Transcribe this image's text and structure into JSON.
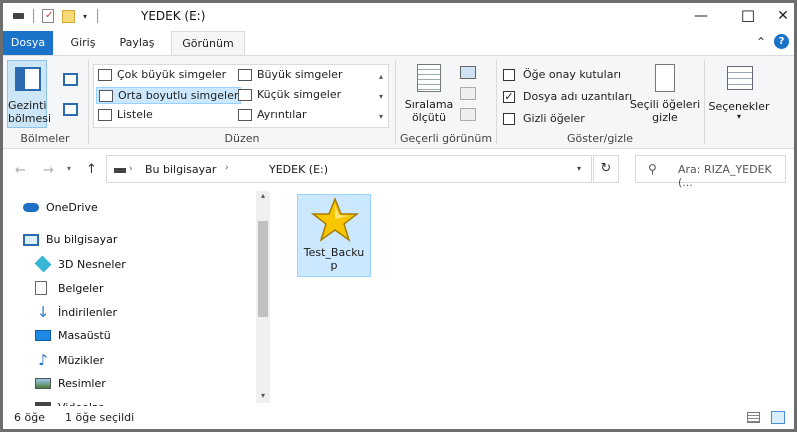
{
  "window": {
    "title": "YEDEK (E:)"
  },
  "window_buttons": {
    "minimize": "—",
    "maximize": "☐",
    "close": "✕"
  },
  "tabs": [
    {
      "label": "Dosya"
    },
    {
      "label": "Giriş"
    },
    {
      "label": "Paylaş"
    },
    {
      "label": "Görünüm"
    }
  ],
  "ribbon": {
    "panes": {
      "nav_pane_line1": "Gezinti",
      "nav_pane_line2": "bölmesi",
      "group": "Bölmeler"
    },
    "layout": {
      "items": [
        "Çok büyük simgeler",
        "Büyük simgeler",
        "Orta boyutlu simgeler",
        "Küçük simgeler",
        "Listele",
        "Ayrıntılar"
      ],
      "group": "Düzen"
    },
    "current_view": {
      "sort_line1": "Sıralama",
      "sort_line2": "ölçütü",
      "group": "Geçerli görünüm"
    },
    "show_hide": {
      "item_checkboxes": "Öğe onay kutuları",
      "file_extensions": "Dosya adı uzantıları",
      "hidden_items": "Gizli öğeler",
      "hide_selected_line1": "Seçili öğeleri",
      "hide_selected_line2": "gizle",
      "group": "Göster/gizle"
    },
    "options": {
      "label": "Seçenekler"
    }
  },
  "address": {
    "segments": [
      "Bu bilgisayar",
      "YEDEK (E:)"
    ],
    "search_placeholder": "Ara: RIZA_YEDEK (..."
  },
  "nav_pane": {
    "items": [
      {
        "label": "OneDrive"
      },
      {
        "label": "Bu bilgisayar"
      },
      {
        "label": "3D Nesneler"
      },
      {
        "label": "Belgeler"
      },
      {
        "label": "İndirilenler"
      },
      {
        "label": "Masaüstü"
      },
      {
        "label": "Müzikler"
      },
      {
        "label": "Resimler"
      },
      {
        "label": "Videolar"
      }
    ]
  },
  "files": [
    {
      "name_line1": "Test_Backu",
      "name_line2": "p"
    }
  ],
  "status": {
    "count": "6 öğe",
    "selected": "1 öğe seçildi"
  },
  "colors": {
    "accent": "#1a73c9",
    "selection": "#cce8ff",
    "selection_border": "#99d1ff",
    "star": "#f7c600"
  }
}
